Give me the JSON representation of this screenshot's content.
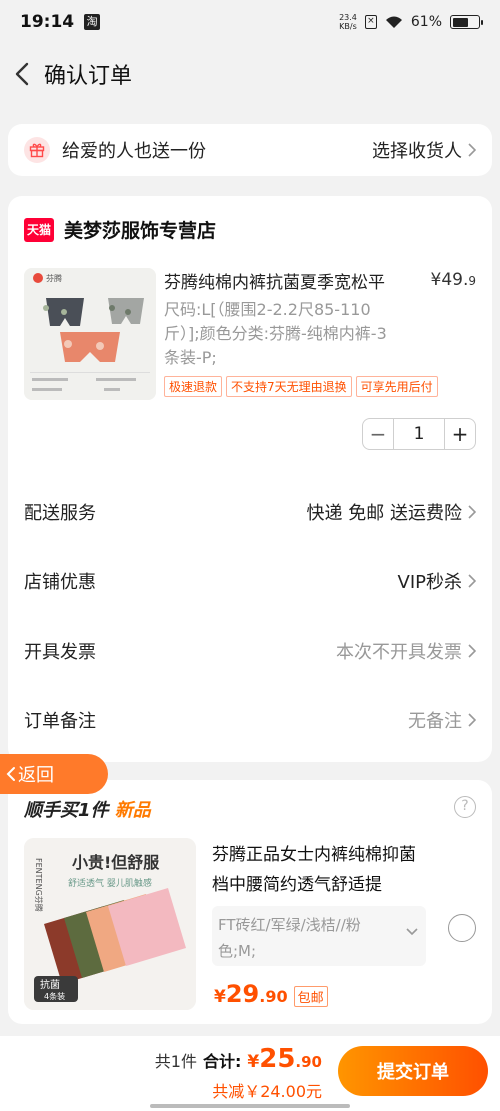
{
  "status": {
    "time": "19:14",
    "net_speed": "23.4",
    "net_unit": "KB/s",
    "battery": "61%",
    "battery_level": 0.61
  },
  "nav": {
    "title": "确认订单"
  },
  "gift": {
    "text": "给爱的人也送一份",
    "action": "选择收货人"
  },
  "shop": {
    "badge": "天猫",
    "name": "美梦莎服饰专营店"
  },
  "product": {
    "title": "芬腾纯棉内裤抗菌夏季宽松平",
    "price_int": "¥49.",
    "price_dec": "9",
    "spec": "尺码:L[（腰围2-2.2尺85-110斤）];颜色分类:芬腾-纯棉内裤-3条装-P;",
    "tags": [
      "极速退款",
      "不支持7天无理由退换",
      "可享先用后付"
    ],
    "quantity": "1",
    "minus": "−",
    "plus": "+",
    "image_brand": "芬腾"
  },
  "rows": {
    "delivery": {
      "label": "配送服务",
      "value": "快递 免邮 送运费险"
    },
    "discount": {
      "label": "店铺优惠",
      "value": "VIP秒杀"
    },
    "invoice": {
      "label": "开具发票",
      "value": "本次不开具发票"
    },
    "note": {
      "label": "订单备注",
      "value": "无备注"
    }
  },
  "return_button": "返回",
  "addon": {
    "title_prefix": "顺手买1件",
    "title_new": "新品",
    "help": "?",
    "name": "芬腾正品女士内裤纯棉抑菌档中腰简约透气舒适提",
    "spec": "FT砖红/军绿/浅桔//粉色;M;",
    "price_cur": "¥",
    "price_int": "29",
    "price_dec": ".90",
    "free_ship": "包邮",
    "image_slogan": "小贵!但舒服",
    "image_sub": "舒适透气 婴儿肌触感",
    "image_badge": "抗菌",
    "image_count": "4条装",
    "image_brand": "FENTENG芬腾"
  },
  "footer": {
    "count": "共1件",
    "total_label": "合计:",
    "total_cur": "¥",
    "total_int": "25",
    "total_dec": ".90",
    "saved": "共减￥24.00元",
    "submit": "提交订单"
  },
  "colors": {
    "accent": "#ff5000",
    "return_orange": "#ff7a2a",
    "tmall_red": "#ff0036",
    "new_orange": "#ff7a00"
  }
}
